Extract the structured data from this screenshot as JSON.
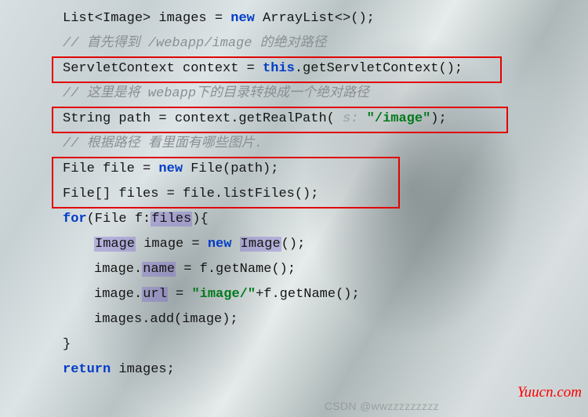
{
  "code": {
    "l1a": "List<Image> images = ",
    "l1b": "new",
    "l1c": " ArrayList<>();",
    "c1a": "// ",
    "c1b": "首先得到 /webapp/image 的绝对路径",
    "l2a": "ServletContext context = ",
    "l2b": "this",
    "l2c": ".getServletContext();",
    "c2a": "// ",
    "c2b": "这里是将 webapp下的目录转换成一个绝对路径",
    "l3a": "String path = context.getRealPath(",
    "l3hint": " s: ",
    "l3b": "\"/image\"",
    "l3c": ");",
    "c3a": "// ",
    "c3b": "根据路径 看里面有哪些图片.",
    "l4a": "File file = ",
    "l4b": "new",
    "l4c": " File(path);",
    "l5a": "File[] files = file.listFiles();",
    "l6a": "for",
    "l6b": "(File f:",
    "l6c": "files",
    "l6d": "){",
    "l7a": "Image",
    "l7b": " image = ",
    "l7c": "new",
    "l7d": " ",
    "l7e": "Image",
    "l7f": "();",
    "l8a": "image.",
    "l8b": "name",
    "l8c": " = f.getName();",
    "l9a": "image.",
    "l9b": "url",
    "l9c": " = ",
    "l9d": "\"image/\"",
    "l9e": "+f.getName();",
    "l10": "images.add(image);",
    "l11": "}",
    "l12a": "return",
    "l12b": " images;"
  },
  "watermark": {
    "csdn": "CSDN @wwzzzzzzzzz",
    "yuucn": "Yuucn.com"
  }
}
